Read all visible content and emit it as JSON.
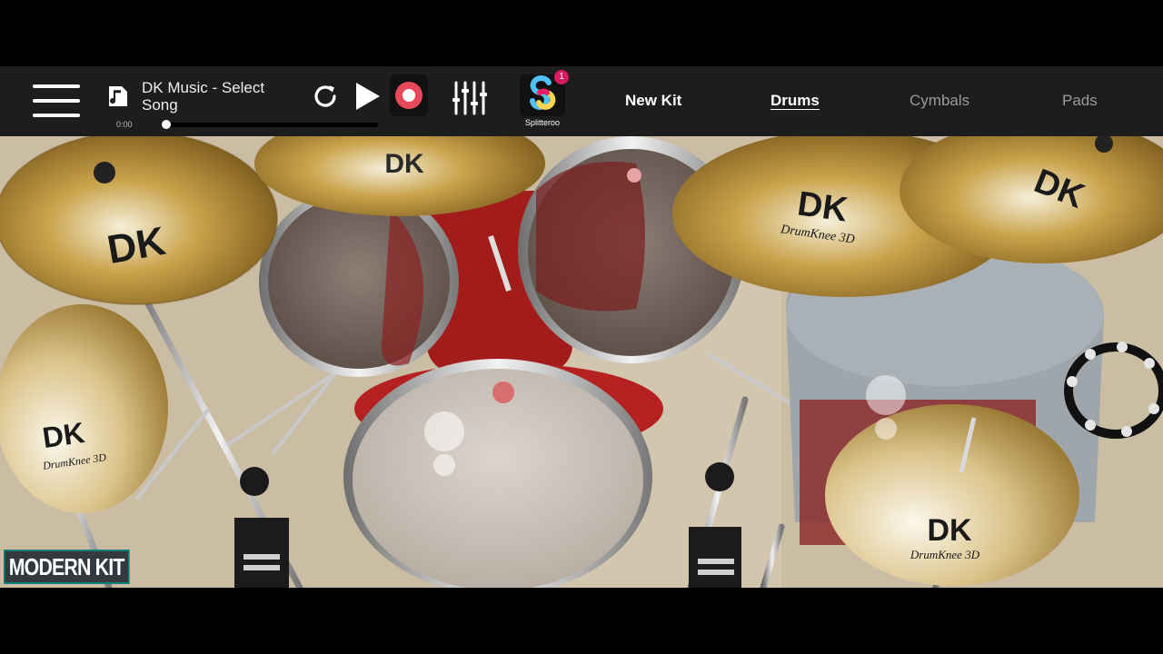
{
  "topbar": {
    "song_title": "DK Music - Select Song",
    "time": "0:00",
    "progress": 0.0,
    "app_name": "Splitteroo",
    "app_badge": "1",
    "record_color": "#e8495a"
  },
  "tabs": [
    {
      "label": "New Kit",
      "active": false
    },
    {
      "label": "Drums",
      "active": true
    },
    {
      "label": "Cymbals",
      "active": false
    },
    {
      "label": "Pads",
      "active": false
    }
  ],
  "scene": {
    "kit_name": "MODERN KIT",
    "brand": "DK",
    "brand_sub": "DrumKnee 3D"
  },
  "icons": [
    "menu-icon",
    "music-note-icon",
    "loop-icon",
    "play-icon",
    "record-icon",
    "mixer-sliders-icon",
    "splitteroo-app-icon"
  ]
}
